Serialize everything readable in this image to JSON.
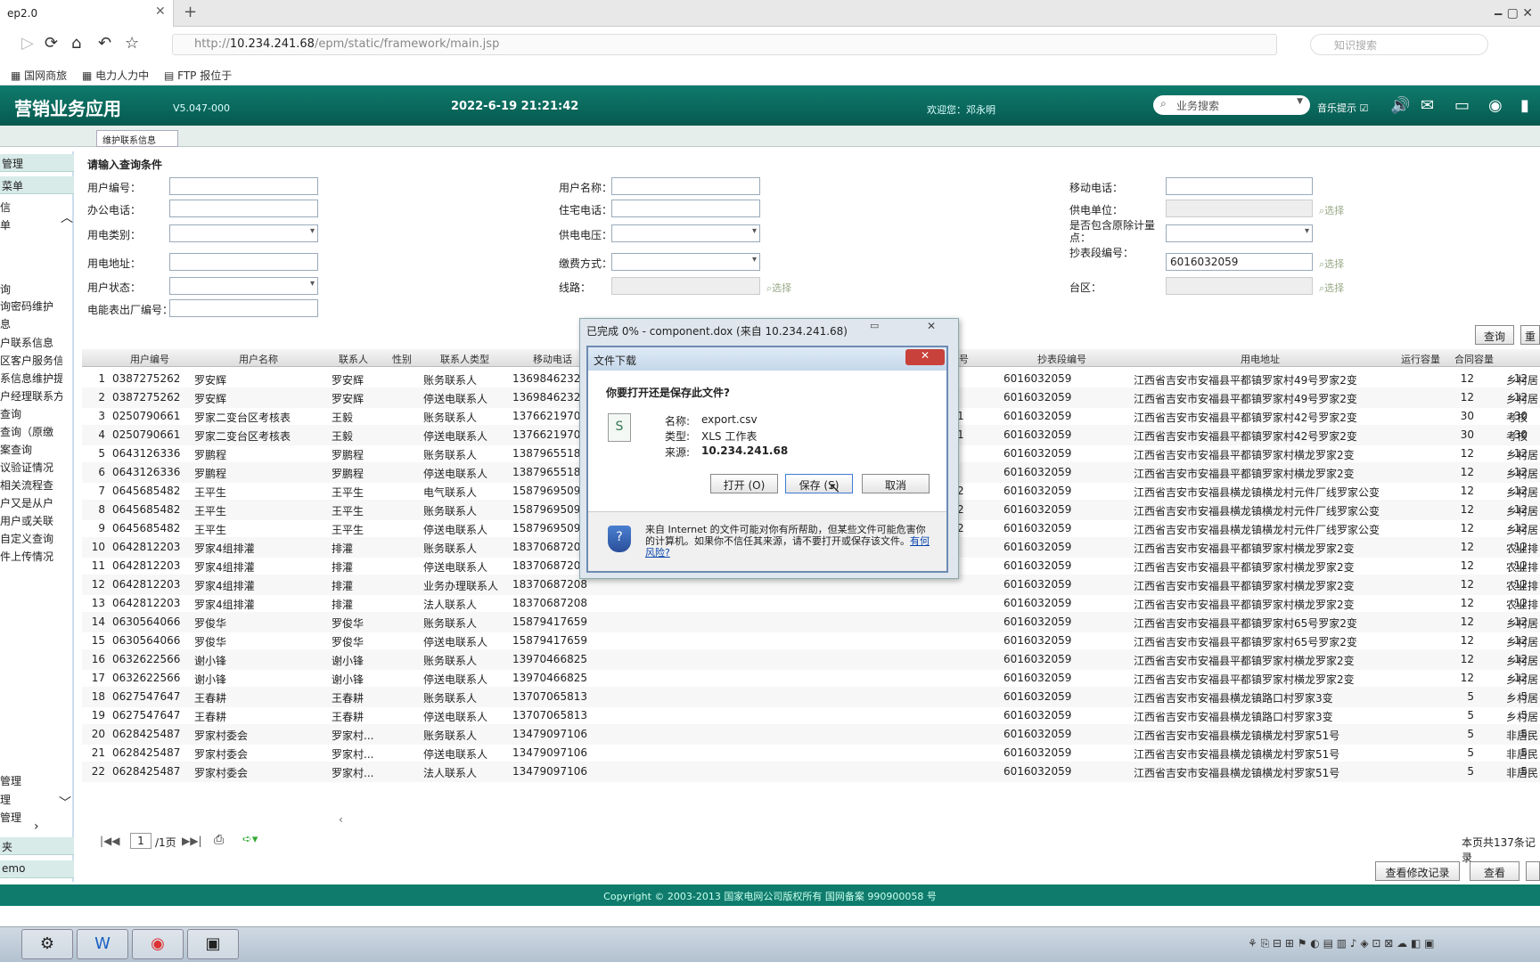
{
  "browser": {
    "tab_title": "ep2.0",
    "address": "http://10.234.241.68/epm/static/framework/main.jsp",
    "address_prefix": "http://",
    "address_host": "10.234.241.68",
    "address_path": "/epm/static/framework/main.jsp",
    "search_placeholder": "知识搜索",
    "bookmarks": [
      "国网商旅",
      "电力人力中",
      "FTP 报位于"
    ]
  },
  "app": {
    "title": "营销业务应用",
    "version": "V5.047-000",
    "datetime": "2022-6-19 21:21:42",
    "welcome": "欢迎您：邓永明",
    "search_placeholder": "业务搜索",
    "sound_label": "音乐提示"
  },
  "subtab": "维护联系信息",
  "sidebar": {
    "headers": [
      "管理",
      "菜单"
    ],
    "items": [
      "信",
      "单",
      "",
      "",
      "询",
      "询密码维护",
      "息",
      "户联系信息",
      "区客户服务信",
      "系信息维护提",
      "户经理联系方",
      "查询",
      "查询（原缴",
      "案查询",
      "议验证情况",
      "相关流程查",
      "户又是从户",
      "用户或关联",
      "自定义查询",
      "件上传情况"
    ],
    "bottom_items": [
      "管理",
      "理",
      "管理"
    ],
    "bottom_headers": [
      "夹",
      "emo"
    ]
  },
  "query": {
    "title": "请输入查询条件",
    "labels": {
      "user_no": "用户编号：",
      "office_phone": "办公电话：",
      "elec_type": "用电类别：",
      "elec_addr": "用电地址：",
      "user_status": "用户状态：",
      "meter_no": "电能表出厂编号：",
      "user_name": "用户名称：",
      "home_phone": "住宅电话：",
      "supply_voltage": "供电电压：",
      "pay_method": "缴费方式：",
      "line": "线路：",
      "mobile": "移动电话：",
      "supply_unit": "供电单位：",
      "include_removed": "是否包含原除计量点：",
      "meter_seg": "抄表段编号：",
      "area": "台区："
    },
    "meter_seg_value": "6016032059",
    "link_label": "选择",
    "search_button": "查询",
    "reset_button": "重"
  },
  "grid": {
    "headers": [
      "用户编号",
      "用户名称",
      "联系人",
      "性别",
      "联系人类型",
      "移动电话",
      "号",
      "抄表段编号",
      "用电地址",
      "运行容量",
      "合同容量"
    ],
    "rows": [
      [
        "1",
        "0387275262",
        "罗安辉",
        "罗安辉",
        "账务联系人",
        "13698462325",
        "",
        "6016032059",
        "江西省吉安市安福县平都镇罗家村49号罗家2变",
        "12",
        "12",
        "乡村居"
      ],
      [
        "2",
        "0387275262",
        "罗安辉",
        "罗安辉",
        "停送电联系人",
        "13698462325",
        "",
        "6016032059",
        "江西省吉安市安福县平都镇罗家村49号罗家2变",
        "12",
        "12",
        "乡村居"
      ],
      [
        "3",
        "0250790661",
        "罗家二变台区考核表",
        "王毅",
        "账务联系人",
        "13766219705",
        "1",
        "6016032059",
        "江西省吉安市安福县平都镇罗家村42号罗家2变",
        "30",
        "30",
        "考核"
      ],
      [
        "4",
        "0250790661",
        "罗家二变台区考核表",
        "王毅",
        "停送电联系人",
        "13766219705",
        "1",
        "6016032059",
        "江西省吉安市安福县平都镇罗家村42号罗家2变",
        "30",
        "30",
        "考核"
      ],
      [
        "5",
        "0643126336",
        "罗鹏程",
        "罗鹏程",
        "账务联系人",
        "13879655182",
        "",
        "6016032059",
        "江西省吉安市安福县平都镇罗家村横龙罗家2变",
        "12",
        "12",
        "乡村居"
      ],
      [
        "6",
        "0643126336",
        "罗鹏程",
        "罗鹏程",
        "停送电联系人",
        "13879655182",
        "",
        "6016032059",
        "江西省吉安市安福县平都镇罗家村横龙罗家2变",
        "12",
        "12",
        "乡村居"
      ],
      [
        "7",
        "0645685482",
        "王平生",
        "王平生",
        "电气联系人",
        "15879695092",
        "2",
        "6016032059",
        "江西省吉安市安福县横龙镇横龙村元件厂线罗家公变",
        "12",
        "12",
        "乡村居"
      ],
      [
        "8",
        "0645685482",
        "王平生",
        "王平生",
        "账务联系人",
        "15879695092",
        "2",
        "6016032059",
        "江西省吉安市安福县横龙镇横龙村元件厂线罗家公变",
        "12",
        "12",
        "乡村居"
      ],
      [
        "9",
        "0645685482",
        "王平生",
        "王平生",
        "停送电联系人",
        "15879695092",
        "2",
        "6016032059",
        "江西省吉安市安福县横龙镇横龙村元件厂线罗家公变",
        "12",
        "12",
        "乡村居"
      ],
      [
        "10",
        "0642812203",
        "罗家4组排灌",
        "排灌",
        "账务联系人",
        "18370687208",
        "",
        "6016032059",
        "江西省吉安市安福县平都镇罗家村横龙罗家2变",
        "12",
        "12",
        "农业排"
      ],
      [
        "11",
        "0642812203",
        "罗家4组排灌",
        "排灌",
        "停送电联系人",
        "18370687208",
        "",
        "6016032059",
        "江西省吉安市安福县平都镇罗家村横龙罗家2变",
        "12",
        "12",
        "农业排"
      ],
      [
        "12",
        "0642812203",
        "罗家4组排灌",
        "排灌",
        "业务办理联系人",
        "18370687208",
        "",
        "6016032059",
        "江西省吉安市安福县平都镇罗家村横龙罗家2变",
        "12",
        "12",
        "农业排"
      ],
      [
        "13",
        "0642812203",
        "罗家4组排灌",
        "排灌",
        "法人联系人",
        "18370687208",
        "",
        "6016032059",
        "江西省吉安市安福县平都镇罗家村横龙罗家2变",
        "12",
        "12",
        "农业排"
      ],
      [
        "14",
        "0630564066",
        "罗俊华",
        "罗俊华",
        "账务联系人",
        "15879417659",
        "",
        "6016032059",
        "江西省吉安市安福县平都镇罗家村65号罗家2变",
        "12",
        "12",
        "乡村居"
      ],
      [
        "15",
        "0630564066",
        "罗俊华",
        "罗俊华",
        "停送电联系人",
        "15879417659",
        "",
        "6016032059",
        "江西省吉安市安福县平都镇罗家村65号罗家2变",
        "12",
        "12",
        "乡村居"
      ],
      [
        "16",
        "0632622566",
        "谢小锋",
        "谢小锋",
        "账务联系人",
        "13970466825",
        "",
        "6016032059",
        "江西省吉安市安福县平都镇罗家村横龙罗家2变",
        "12",
        "12",
        "乡村居"
      ],
      [
        "17",
        "0632622566",
        "谢小锋",
        "谢小锋",
        "停送电联系人",
        "13970466825",
        "",
        "6016032059",
        "江西省吉安市安福县平都镇罗家村横龙罗家2变",
        "12",
        "12",
        "乡村居"
      ],
      [
        "18",
        "0627547647",
        "王春耕",
        "王春耕",
        "账务联系人",
        "13707065813",
        "",
        "6016032059",
        "江西省吉安市安福县横龙镇路口村罗家3变",
        "5",
        "5",
        "乡村居"
      ],
      [
        "19",
        "0627547647",
        "王春耕",
        "王春耕",
        "停送电联系人",
        "13707065813",
        "",
        "6016032059",
        "江西省吉安市安福县横龙镇路口村罗家3变",
        "5",
        "5",
        "乡村居"
      ],
      [
        "20",
        "0628425487",
        "罗家村委会",
        "罗家村...",
        "账务联系人",
        "13479097106",
        "",
        "6016032059",
        "江西省吉安市安福县横龙镇横龙村罗家51号",
        "5",
        "5",
        "非居民"
      ],
      [
        "21",
        "0628425487",
        "罗家村委会",
        "罗家村...",
        "停送电联系人",
        "13479097106",
        "",
        "6016032059",
        "江西省吉安市安福县横龙镇横龙村罗家51号",
        "5",
        "5",
        "非居民"
      ],
      [
        "22",
        "0628425487",
        "罗家村委会",
        "罗家村...",
        "法人联系人",
        "13479097106",
        "",
        "6016032059",
        "江西省吉安市安福县横龙镇横龙村罗家51号",
        "5",
        "5",
        "非居民"
      ]
    ]
  },
  "pager": {
    "page": "1",
    "total_pages": "/1页",
    "summary": "本页共137条记录"
  },
  "bottom": {
    "view_log": "查看修改记录",
    "view": "查看"
  },
  "footer": "Copyright © 2003-2013 国家电网公司版权所有  国网备案 990900058 号",
  "progress_dialog": {
    "title": "已完成 0% - component.dox (来自 10.234.241.68)"
  },
  "download_dialog": {
    "title": "文件下载",
    "question": "你要打开还是保存此文件?",
    "name_label": "名称:",
    "name_value": "export.csv",
    "type_label": "类型:",
    "type_value": "XLS 工作表",
    "source_label": "来源:",
    "source_value": "10.234.241.68",
    "open_button": "打开 (O)",
    "save_button": "保存 (S)",
    "cancel_button": "取消",
    "warning": "来自 Internet 的文件可能对你有所帮助，但某些文件可能危害你的计算机。如果你不信任其来源，请不要打开或保存该文件。",
    "risk_link": "有何风险?"
  }
}
